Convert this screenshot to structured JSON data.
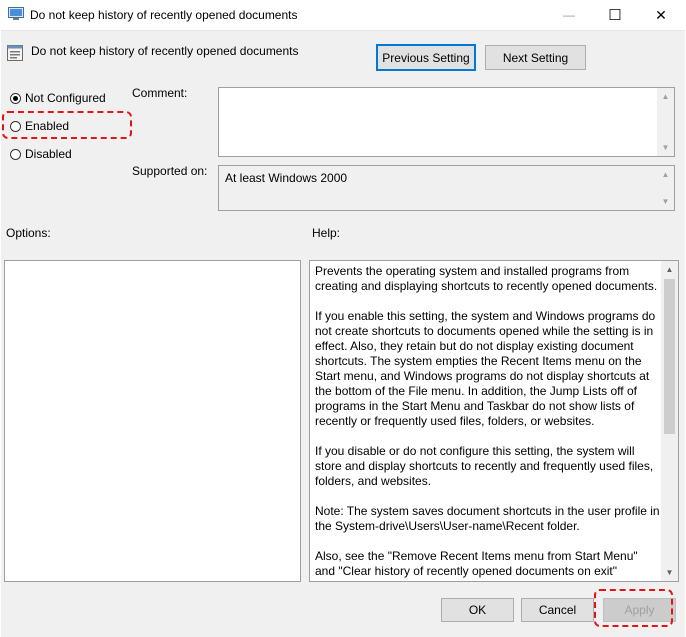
{
  "window": {
    "title": "Do not keep history of recently opened documents",
    "min_glyph": "—",
    "max_glyph": "☐",
    "close_glyph": "✕"
  },
  "header": {
    "policy_title": "Do not keep history of recently opened documents",
    "prev_button": "Previous Setting",
    "next_button": "Next Setting"
  },
  "state": {
    "options": [
      {
        "label": "Not Configured",
        "selected": true
      },
      {
        "label": "Enabled",
        "selected": false
      },
      {
        "label": "Disabled",
        "selected": false
      }
    ]
  },
  "fields": {
    "comment_label": "Comment:",
    "comment_value": "",
    "supported_label": "Supported on:",
    "supported_value": "At least Windows 2000"
  },
  "panes": {
    "options_label": "Options:",
    "help_label": "Help:",
    "help_paragraphs": [
      "Prevents the operating system and installed programs from creating and displaying shortcuts to recently opened documents.",
      "If you enable this setting, the system and Windows programs do not create shortcuts to documents opened while the setting is in effect. Also, they retain but do not display existing document shortcuts. The system empties the Recent Items menu on the Start menu, and Windows programs do not display shortcuts at the bottom of the File menu. In addition, the Jump Lists off of programs in the Start Menu and Taskbar do not show lists of recently or frequently used files, folders, or websites.",
      "If you disable or do not configure this setting, the system will store and display shortcuts to recently and frequently used files, folders, and websites.",
      "Note: The system saves document shortcuts in the user profile in the System-drive\\Users\\User-name\\Recent folder.",
      "Also, see the \"Remove Recent Items menu from Start Menu\" and \"Clear history of recently opened documents on exit\" policies in this folder."
    ]
  },
  "footer": {
    "ok": "OK",
    "cancel": "Cancel",
    "apply": "Apply"
  },
  "colors": {
    "accent": "#0078d7",
    "highlight": "#e01616"
  }
}
